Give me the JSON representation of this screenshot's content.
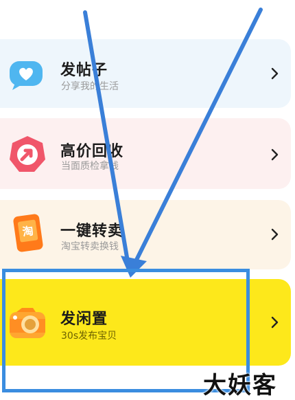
{
  "menu": {
    "items": [
      {
        "title": "发帖子",
        "subtitle": "分享我的生活",
        "icon": "chat-heart-icon"
      },
      {
        "title": "高价回收",
        "subtitle": "当面质检拿钱",
        "icon": "recycle-arrow-icon"
      },
      {
        "title": "一键转卖",
        "subtitle": "淘宝转卖换钱",
        "icon": "taobao-phone-icon"
      },
      {
        "title": "发闲置",
        "subtitle": "30s发布宝贝",
        "icon": "camera-icon"
      }
    ]
  },
  "icons": {
    "chevron": "chevron-right-icon"
  },
  "colors": {
    "highlight_card": "#fde81b",
    "annotation_blue": "#3a8de0",
    "card_blue": "#eef6fc",
    "card_pink": "#fdf0f0",
    "card_peach": "#fdf4e7"
  },
  "watermark": {
    "text": "大妖客"
  }
}
